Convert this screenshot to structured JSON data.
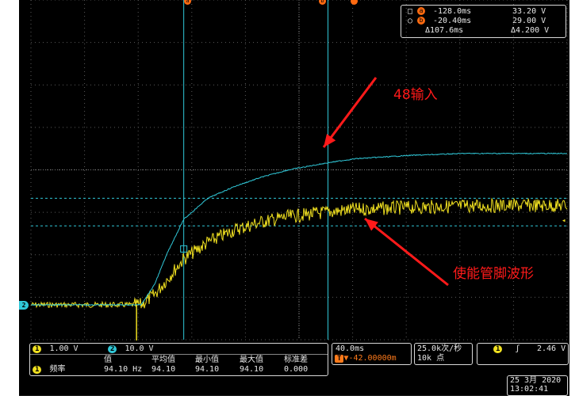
{
  "cursor_readout": {
    "a_time": "-128.0ms",
    "a_volt": "33.20 V",
    "b_time": "-20.40ms",
    "b_volt": "29.00 V",
    "delta_time": "Δ107.6ms",
    "delta_volt": "Δ4.200 V",
    "a_marker": "a",
    "b_marker": "b"
  },
  "annotations": {
    "input_label": "48输入",
    "enable_label": "使能管脚波形"
  },
  "channels": {
    "ch1": {
      "badge": "1",
      "scale": "1.00 V",
      "color": "#f0e020"
    },
    "ch2": {
      "badge": "2",
      "scale": "10.0 V",
      "color": "#30c8d8"
    }
  },
  "measurement": {
    "badge": "1",
    "name": "频率",
    "headers": [
      "值",
      "平均值",
      "最小值",
      "最大值",
      "标准差"
    ],
    "values": [
      "94.10 Hz",
      "94.10",
      "94.10",
      "94.10",
      "0.000"
    ]
  },
  "timebase": {
    "scale": "40.0ms",
    "offset": "▼-42.00000m",
    "offset_badge": "T"
  },
  "acquisition": {
    "rate": "25.0k次/秒",
    "points": "10k 点"
  },
  "trigger": {
    "badge": "1",
    "edge": "ʃ",
    "level": "2.46 V"
  },
  "datetime": {
    "date": "25 3月  2020",
    "time": "13:02:41"
  },
  "chart_data": {
    "type": "line",
    "x_unit": "ms",
    "x_per_div": 40,
    "cursors_x_ms": [
      -128.0,
      -20.4
    ],
    "cursors_y_v": [
      33.2,
      29.0
    ],
    "series": [
      {
        "name": "",
        "channel": 2,
        "color": "#30c8d8",
        "x": [
          -180,
          -165,
          -160,
          -150,
          -140,
          -128,
          -110,
          -90,
          -70,
          -50,
          -20.4,
          0,
          40,
          80,
          120
        ],
        "y": [
          17,
          17,
          17,
          20,
          25,
          30,
          33.2,
          35.0,
          36.4,
          37.5,
          38.6,
          39.2,
          39.7,
          40.0,
          40.0
        ]
      },
      {
        "name": "",
        "channel": 1,
        "color": "#f0e020",
        "x": [
          -180,
          -165,
          -160,
          -150,
          -140,
          -128,
          -110,
          -90,
          -70,
          -50,
          -20.4,
          0,
          40,
          80,
          120
        ],
        "y": [
          17,
          17,
          17,
          18.5,
          21,
          24,
          26.5,
          28.4,
          29.6,
          30.4,
          31.1,
          31.5,
          31.8,
          32.0,
          32.1
        ]
      }
    ]
  }
}
